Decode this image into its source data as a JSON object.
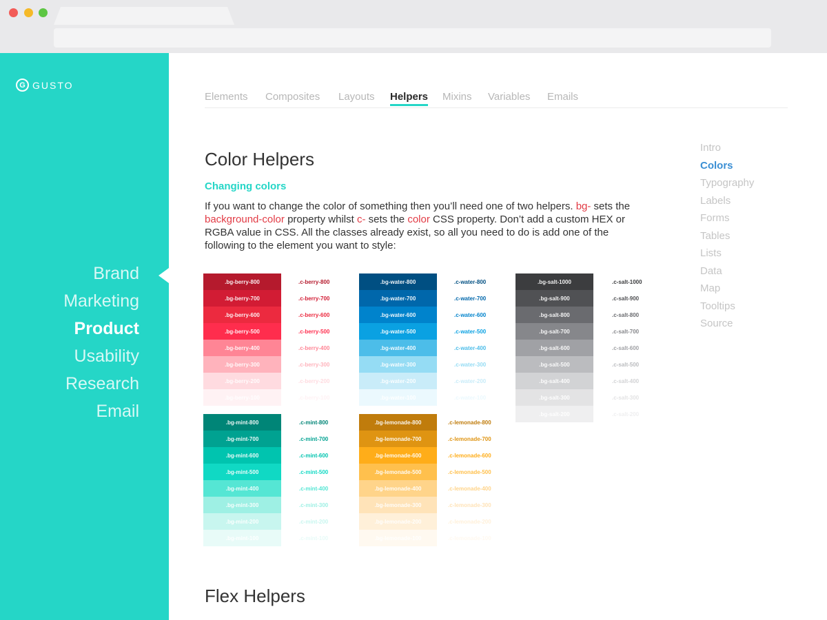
{
  "sidebar": {
    "logo_mark": "G",
    "logo_text": "GUSTO",
    "items": [
      {
        "label": "Brand",
        "active": false
      },
      {
        "label": "Marketing",
        "active": false
      },
      {
        "label": "Product",
        "active": true
      },
      {
        "label": "Usability",
        "active": false
      },
      {
        "label": "Research",
        "active": false
      },
      {
        "label": "Email",
        "active": false
      }
    ]
  },
  "tabs": [
    {
      "label": "Elements",
      "active": false
    },
    {
      "label": "Composites",
      "active": false
    },
    {
      "label": "Layouts",
      "active": false
    },
    {
      "label": "Helpers",
      "active": true
    },
    {
      "label": "Mixins",
      "active": false
    },
    {
      "label": "Variables",
      "active": false
    },
    {
      "label": "Emails",
      "active": false
    }
  ],
  "main": {
    "title": "Color Helpers",
    "subtitle": "Changing colors",
    "para": {
      "t1": "If you want to change the color of something then you’ll need one of two helpers. ",
      "c1": "bg-",
      "t2": " sets the ",
      "c2": "background-color",
      "t3": " property whilst ",
      "c3": "c-",
      "t4": " sets the ",
      "c4": "color",
      "t5": " CSS property. Don’t add a custom HEX or RGBA value in CSS. All the classes already exist, so all you need to do is add one of the following to the element you want to style:"
    },
    "next_title": "Flex Helpers"
  },
  "right_nav": [
    {
      "label": "Intro",
      "active": false
    },
    {
      "label": "Colors",
      "active": true
    },
    {
      "label": "Typography",
      "active": false
    },
    {
      "label": "Labels",
      "active": false
    },
    {
      "label": "Forms",
      "active": false
    },
    {
      "label": "Tables",
      "active": false
    },
    {
      "label": "Lists",
      "active": false
    },
    {
      "label": "Data",
      "active": false
    },
    {
      "label": "Map",
      "active": false
    },
    {
      "label": "Tooltips",
      "active": false
    },
    {
      "label": "Source",
      "active": false
    }
  ],
  "palettes": [
    {
      "name": "berry",
      "swatches": [
        {
          "bg": ".bg-berry-800",
          "text": ".c-berry-800",
          "color": "#b51a2d"
        },
        {
          "bg": ".bg-berry-700",
          "text": ".c-berry-700",
          "color": "#d21c34"
        },
        {
          "bg": ".bg-berry-600",
          "text": ".c-berry-600",
          "color": "#ec2a3f"
        },
        {
          "bg": ".bg-berry-500",
          "text": ".c-berry-500",
          "color": "#ff2d4d"
        },
        {
          "bg": ".bg-berry-400",
          "text": ".c-berry-400",
          "color": "#ff8595"
        },
        {
          "bg": ".bg-berry-300",
          "text": ".c-berry-300",
          "color": "#ffb3bc"
        },
        {
          "bg": ".bg-berry-200",
          "text": ".c-berry-200",
          "color": "#ffdbe0"
        },
        {
          "bg": ".bg-berry-100",
          "text": ".c-berry-100",
          "color": "#fff2f4"
        }
      ]
    },
    {
      "name": "water",
      "swatches": [
        {
          "bg": ".bg-water-800",
          "text": ".c-water-800",
          "color": "#004f82"
        },
        {
          "bg": ".bg-water-700",
          "text": ".c-water-700",
          "color": "#0067ab"
        },
        {
          "bg": ".bg-water-600",
          "text": ".c-water-600",
          "color": "#0083cc"
        },
        {
          "bg": ".bg-water-500",
          "text": ".c-water-500",
          "color": "#0aa1e2"
        },
        {
          "bg": ".bg-water-400",
          "text": ".c-water-400",
          "color": "#4cbde9"
        },
        {
          "bg": ".bg-water-300",
          "text": ".c-water-300",
          "color": "#95dcf4"
        },
        {
          "bg": ".bg-water-200",
          "text": ".c-water-200",
          "color": "#c9ecf9"
        },
        {
          "bg": ".bg-water-100",
          "text": ".c-water-100",
          "color": "#ebf9fe"
        }
      ]
    },
    {
      "name": "salt",
      "swatches": [
        {
          "bg": ".bg-salt-1000",
          "text": ".c-salt-1000",
          "color": "#3c3d3f"
        },
        {
          "bg": ".bg-salt-900",
          "text": ".c-salt-900",
          "color": "#505154"
        },
        {
          "bg": ".bg-salt-800",
          "text": ".c-salt-800",
          "color": "#6a6b6f"
        },
        {
          "bg": ".bg-salt-700",
          "text": ".c-salt-700",
          "color": "#86878b"
        },
        {
          "bg": ".bg-salt-600",
          "text": ".c-salt-600",
          "color": "#a0a1a5"
        },
        {
          "bg": ".bg-salt-500",
          "text": ".c-salt-500",
          "color": "#bbbcbf"
        },
        {
          "bg": ".bg-salt-400",
          "text": ".c-salt-400",
          "color": "#d2d3d5"
        },
        {
          "bg": ".bg-salt-300",
          "text": ".c-salt-300",
          "color": "#e3e3e4"
        },
        {
          "bg": ".bg-salt-200",
          "text": ".c-salt-200",
          "color": "#efeff0"
        }
      ]
    },
    {
      "name": "mint",
      "swatches": [
        {
          "bg": ".bg-mint-800",
          "text": ".c-mint-800",
          "color": "#008577"
        },
        {
          "bg": ".bg-mint-700",
          "text": ".c-mint-700",
          "color": "#00a291"
        },
        {
          "bg": ".bg-mint-600",
          "text": ".c-mint-600",
          "color": "#00c4af"
        },
        {
          "bg": ".bg-mint-500",
          "text": ".c-mint-500",
          "color": "#10d9c4"
        },
        {
          "bg": ".bg-mint-400",
          "text": ".c-mint-400",
          "color": "#55e6d4"
        },
        {
          "bg": ".bg-mint-300",
          "text": ".c-mint-300",
          "color": "#9ef0e4"
        },
        {
          "bg": ".bg-mint-200",
          "text": ".c-mint-200",
          "color": "#c8f6ef"
        },
        {
          "bg": ".bg-mint-100",
          "text": ".c-mint-100",
          "color": "#e8fbf8"
        }
      ]
    },
    {
      "name": "lemonade",
      "swatches": [
        {
          "bg": ".bg-lemonade-800",
          "text": ".c-lemonade-800",
          "color": "#c07c0c"
        },
        {
          "bg": ".bg-lemonade-700",
          "text": ".c-lemonade-700",
          "color": "#df9412"
        },
        {
          "bg": ".bg-lemonade-600",
          "text": ".c-lemonade-600",
          "color": "#ffad19"
        },
        {
          "bg": ".bg-lemonade-500",
          "text": ".c-lemonade-500",
          "color": "#ffc04d"
        },
        {
          "bg": ".bg-lemonade-400",
          "text": ".c-lemonade-400",
          "color": "#ffd48a"
        },
        {
          "bg": ".bg-lemonade-300",
          "text": ".c-lemonade-300",
          "color": "#ffe3b8"
        },
        {
          "bg": ".bg-lemonade-200",
          "text": ".c-lemonade-200",
          "color": "#fff0d9"
        },
        {
          "bg": ".bg-lemonade-100",
          "text": ".c-lemonade-100",
          "color": "#fff9f0"
        }
      ]
    }
  ]
}
